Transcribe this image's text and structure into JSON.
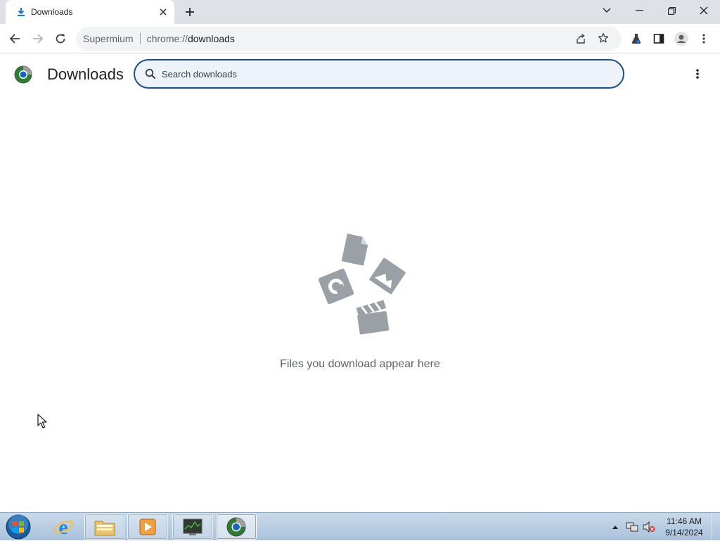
{
  "tab": {
    "title": "Downloads",
    "icon": "download-icon"
  },
  "window_controls": {
    "tab_search": "chevron-down-icon",
    "minimize": "minimize-icon",
    "restore": "restore-icon",
    "close": "close-icon"
  },
  "toolbar": {
    "site_name": "Supermium",
    "url_scheme": "chrome://",
    "url_path": "downloads"
  },
  "page": {
    "title": "Downloads",
    "search_placeholder": "Search downloads",
    "empty_message": "Files you download appear here"
  },
  "taskbar": {
    "apps": [
      "start-orb",
      "internet-explorer",
      "file-explorer",
      "media-player",
      "task-manager",
      "supermium"
    ],
    "clock_time": "11:46 AM",
    "clock_date": "9/14/2024"
  },
  "colors": {
    "accent": "#1f4f8a",
    "icon_gray": "#9aa0a6",
    "tab_bg": "#dee1e6"
  }
}
